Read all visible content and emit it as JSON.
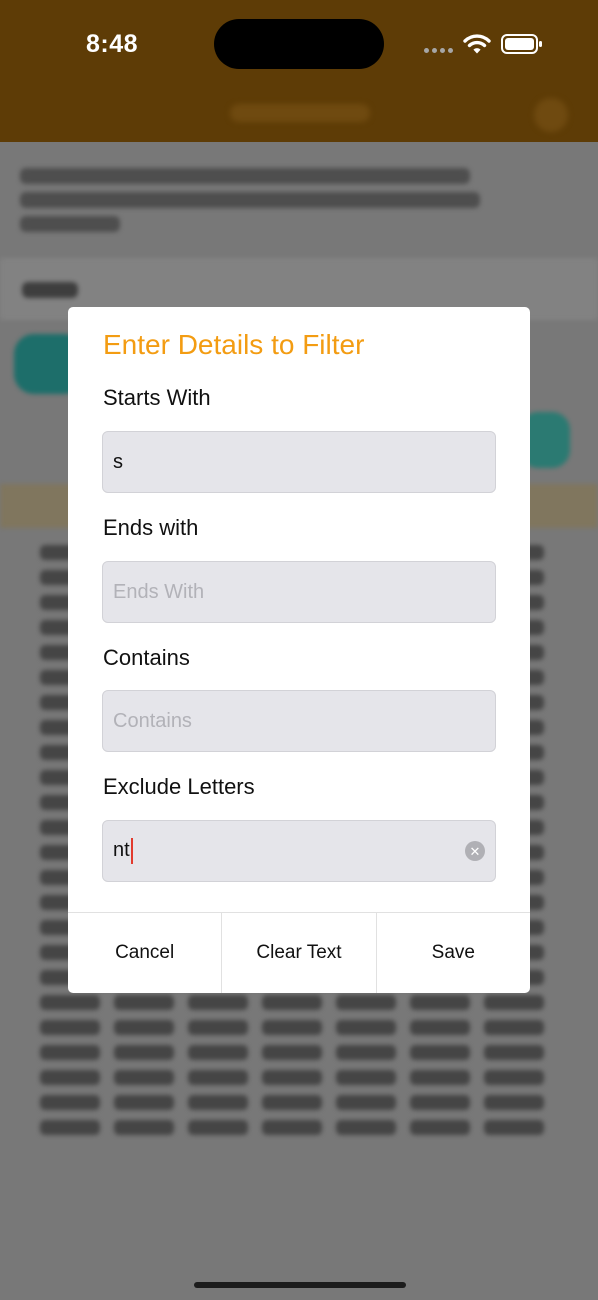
{
  "status_bar": {
    "time": "8:48"
  },
  "dialog": {
    "title": "Enter Details to Filter",
    "fields": [
      {
        "label": "Starts With",
        "value": "s",
        "placeholder": "Starts With"
      },
      {
        "label": "Ends with",
        "value": "",
        "placeholder": "Ends With"
      },
      {
        "label": "Contains",
        "value": "",
        "placeholder": "Contains"
      },
      {
        "label": "Exclude Letters",
        "value": "nt",
        "placeholder": "Exclude Letters"
      }
    ],
    "buttons": {
      "cancel": "Cancel",
      "clear": "Clear Text",
      "save": "Save"
    }
  },
  "colors": {
    "accent": "#f39c12",
    "header": "#5e3c06",
    "field_bg": "#e5e5ea",
    "caret": "#e23b2e"
  },
  "icons": [
    "wifi-icon",
    "battery-icon",
    "clear-text-icon"
  ]
}
